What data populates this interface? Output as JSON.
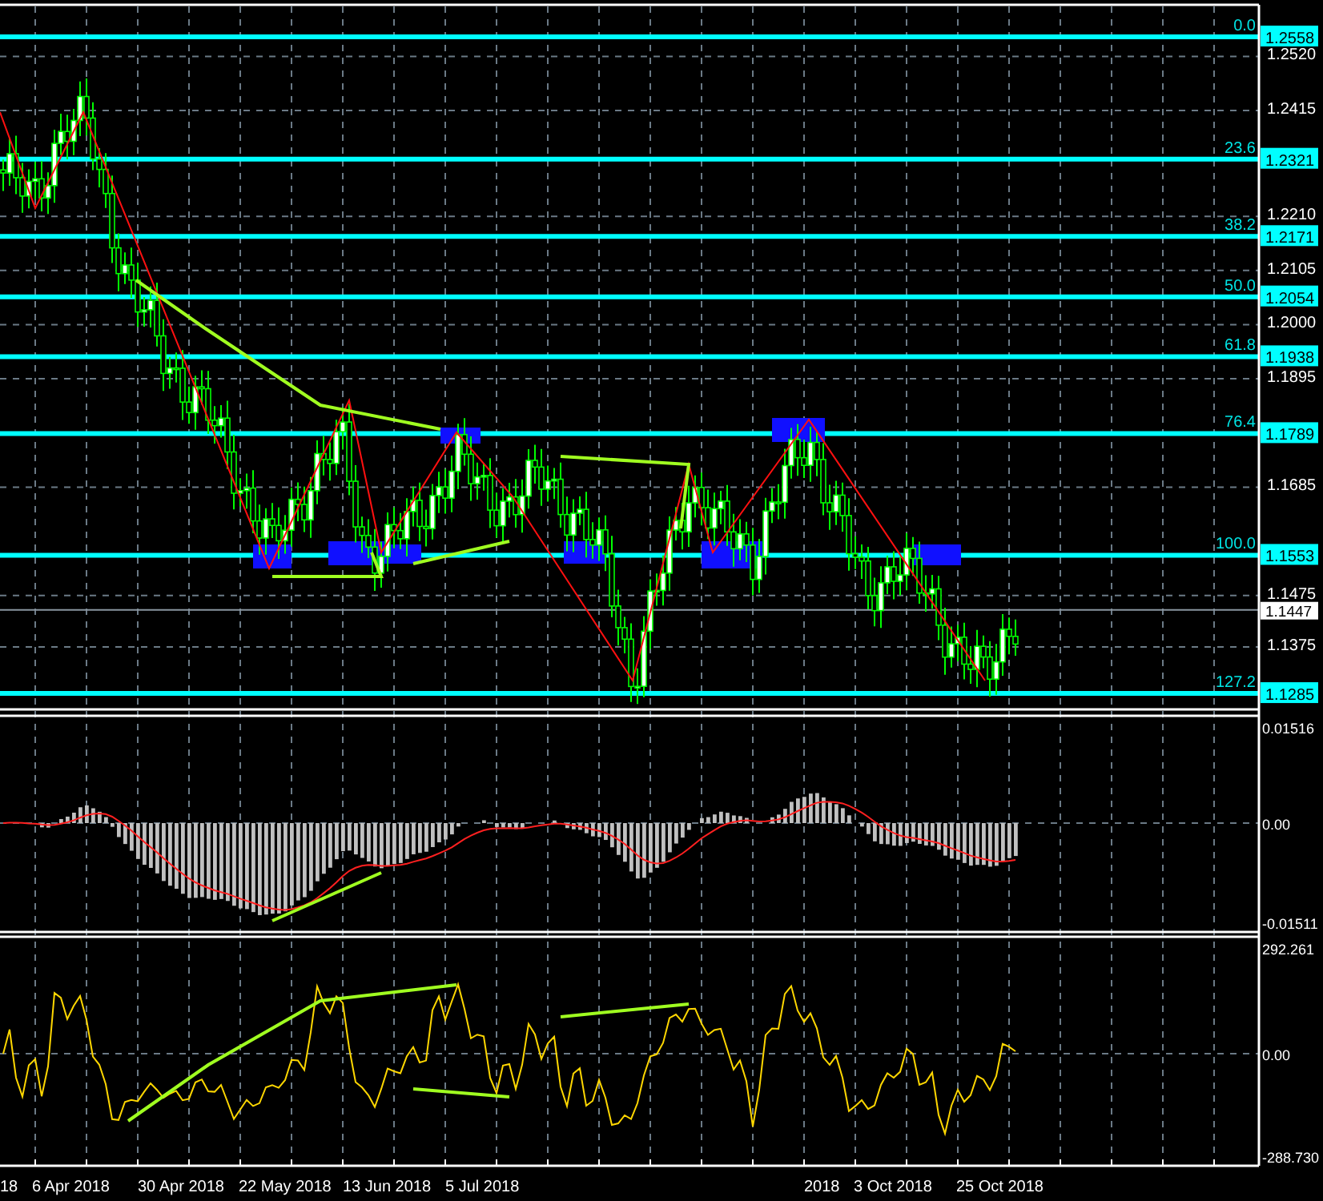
{
  "price_panel": {
    "axis_labels": [
      "1.2520",
      "1.2415",
      "1.2210",
      "1.2105",
      "1.2000",
      "1.1895",
      "1.1685",
      "1.1475",
      "1.1375"
    ],
    "fib_levels": [
      {
        "ratio": "0.0",
        "price": "1.2558"
      },
      {
        "ratio": "23.6",
        "price": "1.2321"
      },
      {
        "ratio": "38.2",
        "price": "1.2171"
      },
      {
        "ratio": "50.0",
        "price": "1.2054"
      },
      {
        "ratio": "61.8",
        "price": "1.1938"
      },
      {
        "ratio": "76.4",
        "price": "1.1789"
      },
      {
        "ratio": "100.0",
        "price": "1.1553"
      },
      {
        "ratio": "127.2",
        "price": "1.1285"
      }
    ],
    "current_price": "1.1447"
  },
  "macd_panel": {
    "axis_labels": [
      "0.01516",
      "0.00",
      "-0.01511"
    ]
  },
  "cci_panel": {
    "axis_labels": [
      "292.261",
      "0.00",
      "-288.730"
    ]
  },
  "time_axis": {
    "labels": [
      "18",
      "6 Apr 2018",
      "30 Apr 2018",
      "22 May 2018",
      "13 Jun 2018",
      "5 Jul 2018",
      "2018",
      "3 Oct 2018",
      "25 Oct 2018"
    ]
  }
}
